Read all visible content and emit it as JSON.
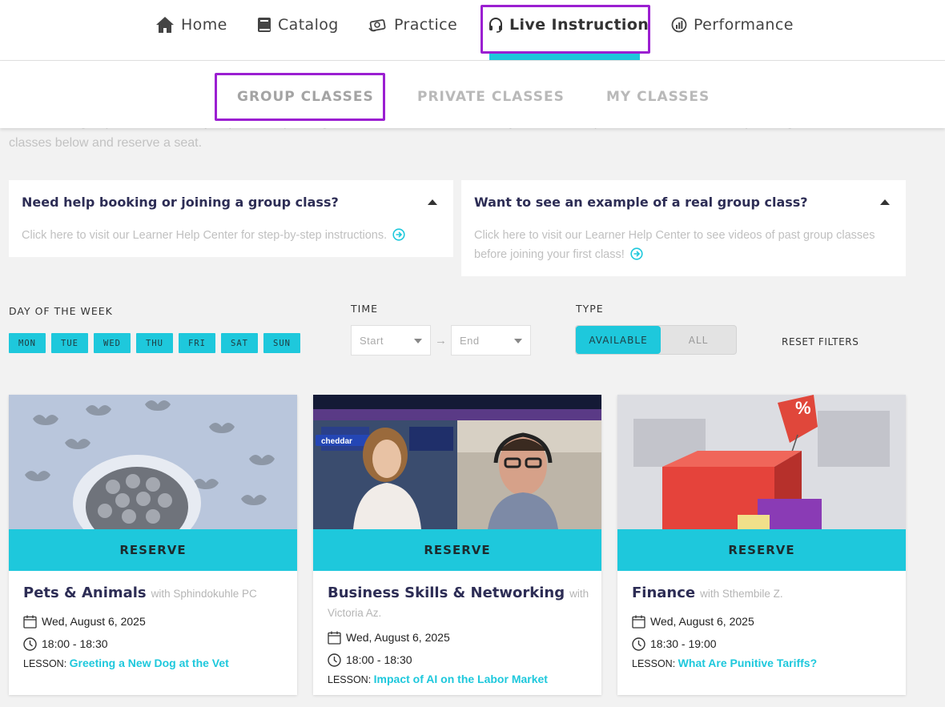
{
  "topnav": {
    "items": [
      {
        "label": "Home",
        "icon": "home-icon"
      },
      {
        "label": "Catalog",
        "icon": "book-icon"
      },
      {
        "label": "Practice",
        "icon": "practice-icon"
      },
      {
        "label": "Live Instruction",
        "icon": "headset-icon",
        "active": true
      },
      {
        "label": "Performance",
        "icon": "performance-icon"
      }
    ]
  },
  "subnav": {
    "items": [
      {
        "label": "GROUP CLASSES",
        "active": true
      },
      {
        "label": "PRIVATE CLASSES"
      },
      {
        "label": "MY CLASSES"
      }
    ]
  },
  "intro": {
    "line1": "Welcome to group classes, where you practice speaking with other learners, facilitated by one of our expert teachers. Check our upcoming",
    "line2": "classes below and reserve a seat."
  },
  "help": [
    {
      "title": "Need help booking or joining a group class?",
      "text": "Click here to visit our Learner Help Center for step-by-step instructions."
    },
    {
      "title": "Want to see an example of a real group class?",
      "text": "Click here to visit our Learner Help Center to see videos of past group classes before joining your first class!"
    }
  ],
  "filters": {
    "day_label": "DAY OF THE WEEK",
    "days": [
      "MON",
      "TUE",
      "WED",
      "THU",
      "FRI",
      "SAT",
      "SUN"
    ],
    "time_label": "TIME",
    "start_placeholder": "Start",
    "end_placeholder": "End",
    "type_label": "TYPE",
    "type_available": "AVAILABLE",
    "type_all": "ALL",
    "reset": "RESET FILTERS"
  },
  "classes": [
    {
      "reserve": "RESERVE",
      "title": "Pets & Animals",
      "with": "with Sphindokuhle PC",
      "date": "Wed, August 6, 2025",
      "time": "18:00 - 18:30",
      "lesson_label": "LESSON:",
      "lesson": "Greeting a New Dog at the Vet"
    },
    {
      "reserve": "RESERVE",
      "title": "Business Skills & Networking",
      "with": "with Victoria Az.",
      "date": "Wed, August 6, 2025",
      "time": "18:00 - 18:30",
      "lesson_label": "LESSON:",
      "lesson": "Impact of AI on the Labor Market",
      "image_label": "cheddar"
    },
    {
      "reserve": "RESERVE",
      "title": "Finance",
      "with": "with Sthembile Z.",
      "date": "Wed, August 6, 2025",
      "time": "18:30 - 19:00",
      "lesson_label": "LESSON:",
      "lesson": "What Are Punitive Tariffs?",
      "image_label": "%"
    }
  ],
  "colors": {
    "accent": "#1ec8dc",
    "highlight": "#9b1fd1",
    "title": "#2d2d55"
  }
}
